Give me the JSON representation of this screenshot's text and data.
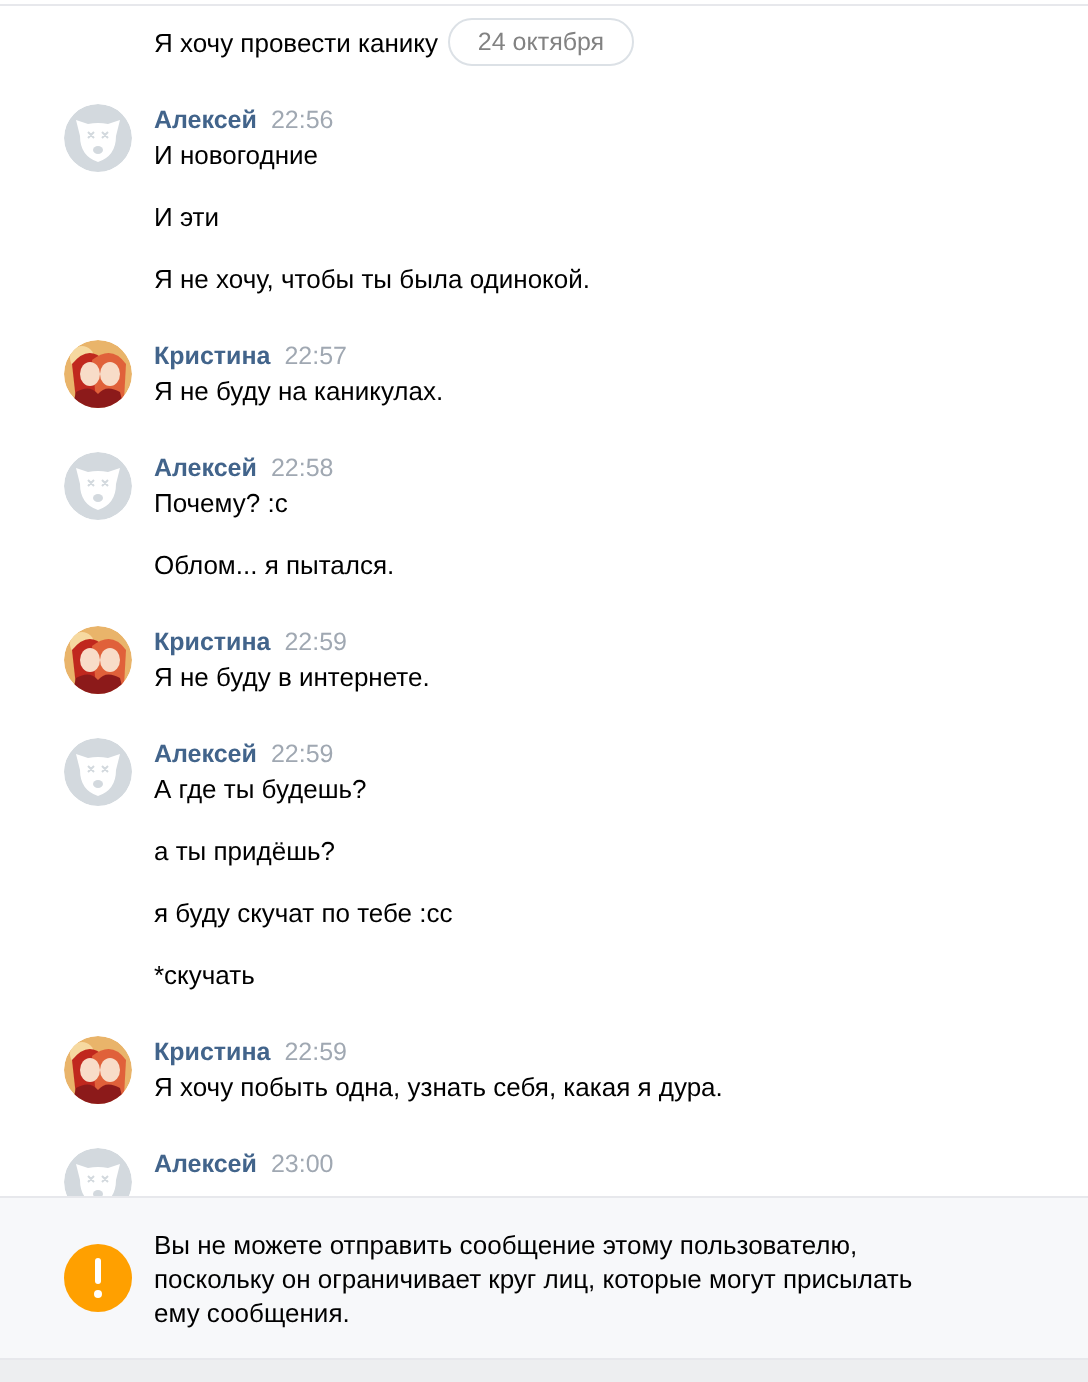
{
  "date_divider": "24 октября",
  "groups": [
    {
      "messages": [
        "Я хочу провести канику"
      ]
    },
    {
      "sender": "Алексей",
      "time": "22:56",
      "avatar": {
        "kind": "default"
      },
      "messages": [
        "И новогодние",
        "И эти",
        "Я не хочу, чтобы ты была одинокой."
      ]
    },
    {
      "sender": "Кристина",
      "time": "22:57",
      "avatar": {
        "kind": "picture"
      },
      "messages": [
        "Я не буду на каникулах."
      ]
    },
    {
      "sender": "Алексей",
      "time": "22:58",
      "avatar": {
        "kind": "default"
      },
      "messages": [
        "Почему? :c",
        "Облом... я пытался."
      ]
    },
    {
      "sender": "Кристина",
      "time": "22:59",
      "avatar": {
        "kind": "picture"
      },
      "messages": [
        "Я не буду в интернете."
      ]
    },
    {
      "sender": "Алексей",
      "time": "22:59",
      "avatar": {
        "kind": "default"
      },
      "messages": [
        "А где ты будешь?",
        "а ты придёшь?",
        "я буду скучат по тебе :cc",
        "*скучать"
      ]
    },
    {
      "sender": "Кристина",
      "time": "22:59",
      "avatar": {
        "kind": "picture"
      },
      "messages": [
        "Я хочу побыть одна, узнать себя, какая я дура."
      ]
    },
    {
      "sender": "Алексей",
      "time": "23:00",
      "avatar": {
        "kind": "default"
      }
    }
  ],
  "notice": {
    "text": "Вы не можете отправить сообщение этому пользователю, поскольку он ограничивает круг лиц, которые могут присылать ему сообщения."
  }
}
